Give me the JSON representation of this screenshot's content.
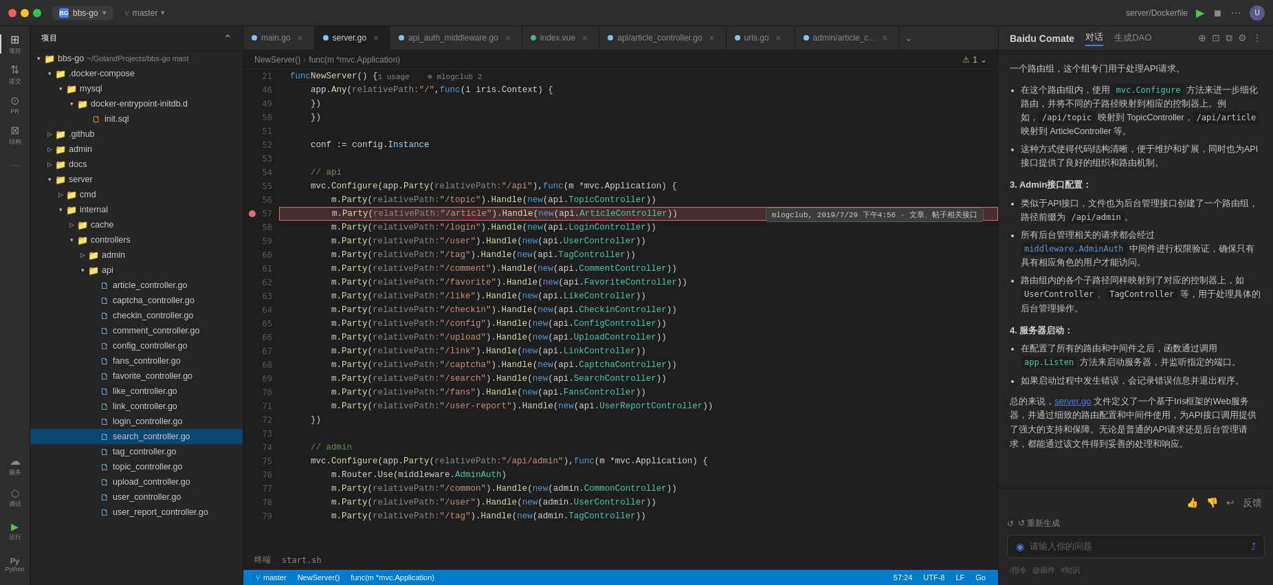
{
  "titlebar": {
    "project_dot": "BG",
    "project_name": "bbs-go",
    "branch_icon": "⑂",
    "branch_name": "master",
    "server_label": "server/Dockerfile",
    "run_icon": "▶",
    "more_icon": "⋯",
    "avatar_label": "U"
  },
  "sidebar": {
    "header": "项目",
    "root": {
      "name": "bbs-go",
      "path": "~/GolandProjects/bbs-go mast",
      "children": [
        {
          "name": ".docker-compose",
          "type": "folder",
          "expanded": true
        },
        {
          "name": "mysql",
          "type": "folder",
          "indent": 1
        },
        {
          "name": "docker-entrypoint-initdb.d",
          "type": "folder",
          "indent": 2
        },
        {
          "name": "init.sql",
          "type": "file",
          "fileType": "sql",
          "indent": 3
        },
        {
          "name": ".github",
          "type": "folder",
          "indent": 0
        },
        {
          "name": "admin",
          "type": "folder",
          "indent": 0
        },
        {
          "name": "docs",
          "type": "folder",
          "indent": 0
        },
        {
          "name": "server",
          "type": "folder",
          "expanded": true,
          "indent": 0
        },
        {
          "name": "cmd",
          "type": "folder",
          "indent": 1
        },
        {
          "name": "internal",
          "type": "folder",
          "expanded": true,
          "indent": 1
        },
        {
          "name": "cache",
          "type": "folder",
          "indent": 2
        },
        {
          "name": "controllers",
          "type": "folder",
          "expanded": true,
          "indent": 2
        },
        {
          "name": "admin",
          "type": "folder",
          "indent": 3
        },
        {
          "name": "api",
          "type": "folder",
          "expanded": true,
          "indent": 3
        },
        {
          "name": "article_controller.go",
          "type": "file",
          "fileType": "go",
          "indent": 4
        },
        {
          "name": "captcha_controller.go",
          "type": "file",
          "fileType": "go",
          "indent": 4
        },
        {
          "name": "checkin_controller.go",
          "type": "file",
          "fileType": "go",
          "indent": 4
        },
        {
          "name": "comment_controller.go",
          "type": "file",
          "fileType": "go",
          "indent": 4
        },
        {
          "name": "config_controller.go",
          "type": "file",
          "fileType": "go",
          "indent": 4
        },
        {
          "name": "fans_controller.go",
          "type": "file",
          "fileType": "go",
          "indent": 4
        },
        {
          "name": "favorite_controller.go",
          "type": "file",
          "fileType": "go",
          "indent": 4
        },
        {
          "name": "like_controller.go",
          "type": "file",
          "fileType": "go",
          "indent": 4
        },
        {
          "name": "link_controller.go",
          "type": "file",
          "fileType": "go",
          "indent": 4
        },
        {
          "name": "login_controller.go",
          "type": "file",
          "fileType": "go",
          "indent": 4
        },
        {
          "name": "search_controller.go",
          "type": "file",
          "fileType": "go",
          "indent": 4,
          "selected": true
        },
        {
          "name": "tag_controller.go",
          "type": "file",
          "fileType": "go",
          "indent": 4
        },
        {
          "name": "topic_controller.go",
          "type": "file",
          "fileType": "go",
          "indent": 4
        },
        {
          "name": "upload_controller.go",
          "type": "file",
          "fileType": "go",
          "indent": 4
        },
        {
          "name": "user_controller.go",
          "type": "file",
          "fileType": "go",
          "indent": 4
        },
        {
          "name": "user_report_controller.go",
          "type": "file",
          "fileType": "go",
          "indent": 4
        }
      ]
    }
  },
  "tabs": [
    {
      "name": "main.go",
      "type": "go",
      "active": false
    },
    {
      "name": "server.go",
      "type": "go",
      "active": true,
      "modified": true
    },
    {
      "name": "api_auth_middleware.go",
      "type": "go",
      "active": false
    },
    {
      "name": "index.vue",
      "type": "vue",
      "active": false
    },
    {
      "name": "api/article_controller.go",
      "type": "go",
      "active": false
    },
    {
      "name": "urls.go",
      "type": "go",
      "active": false
    },
    {
      "name": "admin/article_c...",
      "type": "go",
      "active": false
    }
  ],
  "editor": {
    "filename": "server.go",
    "func_signature": "NewServer()",
    "func_context": "func(m *mvc.Application)",
    "warning_text": "⚠ 1",
    "usage_text": "1 usage",
    "mlog_text": "⊕ mlogclub 2",
    "lines": [
      {
        "num": 21,
        "content": "func NewServer() { 1 usage  ⊕ mlogclub 2"
      },
      {
        "num": 46,
        "content": "    app.Any( relativePath: \"/\", func(i iris.Context) {"
      },
      {
        "num": 49,
        "content": "    })"
      },
      {
        "num": 50,
        "content": "    })"
      },
      {
        "num": 51,
        "content": ""
      },
      {
        "num": 52,
        "content": "    conf := config.Instance"
      },
      {
        "num": 53,
        "content": ""
      },
      {
        "num": 54,
        "content": "    // api"
      },
      {
        "num": 55,
        "content": "    mvc.Configure(app.Party( relativePath: \"/api\"), func(m *mvc.Application) {"
      },
      {
        "num": 56,
        "content": "        m.Party( relativePath: \"/topic\").Handle(new(api.TopicController))"
      },
      {
        "num": 57,
        "content": "        m.Party( relativePath: \"/article\").Handle(new(api.ArticleController))",
        "breakpoint": true,
        "highlighted": true,
        "commit_info": "mlogclub, 2019/7/29 下午4:56 · 文章、帖子相关接口"
      },
      {
        "num": 58,
        "content": "        m.Party( relativePath: \"/login\").Handle(new(api.LoginController))"
      },
      {
        "num": 59,
        "content": "        m.Party( relativePath: \"/user\").Handle(new(api.UserController))"
      },
      {
        "num": 60,
        "content": "        m.Party( relativePath: \"/tag\").Handle(new(api.TagController))"
      },
      {
        "num": 61,
        "content": "        m.Party( relativePath: \"/comment\").Handle(new(api.CommentController))"
      },
      {
        "num": 62,
        "content": "        m.Party( relativePath: \"/favorite\").Handle(new(api.FavoriteController))"
      },
      {
        "num": 63,
        "content": "        m.Party( relativePath: \"/like\").Handle(new(api.LikeController))"
      },
      {
        "num": 64,
        "content": "        m.Party( relativePath: \"/checkin\").Handle(new(api.CheckinController))"
      },
      {
        "num": 65,
        "content": "        m.Party( relativePath: \"/config\").Handle(new(api.ConfigController))"
      },
      {
        "num": 66,
        "content": "        m.Party( relativePath: \"/upload\").Handle(new(api.UploadController))"
      },
      {
        "num": 67,
        "content": "        m.Party( relativePath: \"/link\").Handle(new(api.LinkController))"
      },
      {
        "num": 68,
        "content": "        m.Party( relativePath: \"/captcha\").Handle(new(api.CaptchaController))"
      },
      {
        "num": 69,
        "content": "        m.Party( relativePath: \"/search\").Handle(new(api.SearchController))"
      },
      {
        "num": 70,
        "content": "        m.Party( relativePath: \"/fans\").Handle(new(api.FansController))"
      },
      {
        "num": 71,
        "content": "        m.Party( relativePath: \"/user-report\").Handle(new(api.UserReportController))"
      },
      {
        "num": 72,
        "content": "    })"
      },
      {
        "num": 73,
        "content": ""
      },
      {
        "num": 74,
        "content": "    // admin"
      },
      {
        "num": 75,
        "content": "    mvc.Configure(app.Party( relativePath: \"/api/admin\"), func(m *mvc.Application) {"
      },
      {
        "num": 76,
        "content": "        m.Router.Use(middleware.AdminAuth)"
      },
      {
        "num": 77,
        "content": "        m.Party( relativePath: \"/common\").Handle(new(admin.CommonController))"
      },
      {
        "num": 78,
        "content": "        m.Party( relativePath: \"/user\").Handle(new(admin.UserController))"
      },
      {
        "num": 79,
        "content": "        m.Party( relativePath: \"/tag\").Handle(new(admin.TagController))"
      }
    ]
  },
  "ai_panel": {
    "title": "Baidu Comate",
    "tabs": [
      "对话",
      "生成DAO"
    ],
    "active_tab": "对话",
    "content": {
      "paragraph1": "一个路由组，这个组专门用于处理API请求。",
      "bullet1": "在这个路由组内，使用 mvc.Configure 方法来进一步细化路由，并将不同的子路径映射到相应的控制器上。例如，/api/topic 映射到 TopicController，/api/article 映射到 ArticleController 等。",
      "bullet2": "这种方式使得代码结构清晰，便于维护和扩展，同时也为API接口提供了良好的组织和路由机制。",
      "section2": "3. Admin接口配置：",
      "admin_bullet1": "类似于API接口，文件也为后台管理接口创建了一个路由组，路径前缀为 /api/admin。",
      "admin_bullet2": "所有后台管理相关的请求都会经过 middleware.AdminAuth 中间件进行权限验证，确保只有具有相应角色的用户才能访问。",
      "admin_bullet3": "路由组内的各个子路径同样映射到了对应的控制器上，如 UserController、TagController 等，用于处理具体的后台管理操作。",
      "section3": "4. 服务器启动：",
      "server_bullet1": "在配置了所有的路由和中间件之后，函数通过调用 app.Listen 方法来启动服务器，并监听指定的端口。",
      "server_bullet2": "如果启动过程中发生错误，会记录错误信息并退出程序。",
      "conclusion": "总的来说，server.go 文件定义了一个基于Iris框架的Web服务器，并通过细致的路由配置和中间件使用，为API接口调用提供了强大的支持和保障。无论是普通的API请求还是后台管理请求，都能通过该文件得到妥善的处理和响应。",
      "regen_label": "↺ 重新生成",
      "input_placeholder": "请输入你的问题",
      "hint1": "/指令",
      "hint2": "@插件",
      "hint3": "#知识"
    }
  },
  "status_bar": {
    "branch": "master",
    "function": "NewServer()",
    "function2": "func(m *mvc.Application)",
    "encoding": "UTF-8",
    "line_ending": "LF",
    "language": "Go",
    "line_col": "57:24"
  },
  "terminal": {
    "label": "终端",
    "content": "start.sh"
  },
  "activity_items": [
    {
      "icon": "⊞",
      "label": "项目",
      "active": true
    },
    {
      "icon": "↕",
      "label": "提交"
    },
    {
      "icon": "⊙",
      "label": "PR"
    },
    {
      "icon": "⊠",
      "label": "结构"
    },
    {
      "icon": "⋮⋮⋮",
      "label": ""
    }
  ],
  "activity_bottom": [
    {
      "icon": "☁",
      "label": "服务"
    },
    {
      "icon": "⬡",
      "label": "调试"
    },
    {
      "icon": "▶",
      "label": "运行"
    },
    {
      "icon": "Py",
      "label": "Python"
    }
  ]
}
